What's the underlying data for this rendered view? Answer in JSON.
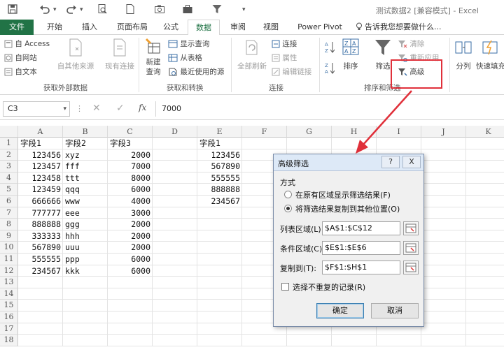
{
  "titlebar": {
    "doc_title": "测试数据2 [兼容模式] - Excel"
  },
  "tabs": [
    {
      "label": "文件"
    },
    {
      "label": "开始"
    },
    {
      "label": "插入"
    },
    {
      "label": "页面布局"
    },
    {
      "label": "公式"
    },
    {
      "label": "数据"
    },
    {
      "label": "审阅"
    },
    {
      "label": "视图"
    },
    {
      "label": "Power Pivot"
    },
    {
      "label": "告诉我您想要做什么..."
    }
  ],
  "active_tab": "数据",
  "ribbon": {
    "get_external": {
      "access": "自 Access",
      "web": "自网站",
      "text": "自文本",
      "other_sources": "自其他来源",
      "existing": "现有连接",
      "group_label": "获取外部数据"
    },
    "get_transform": {
      "show_query": "显示查询",
      "from_table": "从表格",
      "new_query": "新建",
      "new_query_2": "查询",
      "recent_sources": "最近使用的源",
      "group_label": "获取和转换"
    },
    "connections": {
      "refresh_all": "全部刷新",
      "connections": "连接",
      "properties": "属性",
      "edit_links": "编辑链接",
      "group_label": "连接"
    },
    "sort_filter": {
      "sort": "排序",
      "filter": "筛选",
      "clear": "清除",
      "reapply": "重新应用",
      "advanced": "高级",
      "group_label": "排序和筛选"
    },
    "tools": {
      "split": "分列",
      "flash_fill": "快速填充"
    }
  },
  "formula_bar": {
    "name_box": "C3",
    "formula": "7000"
  },
  "grid": {
    "columns": [
      "A",
      "B",
      "C",
      "D",
      "E",
      "F",
      "G",
      "H",
      "I",
      "J",
      "K"
    ],
    "rows": [
      "1",
      "2",
      "3",
      "4",
      "5",
      "6",
      "7",
      "8",
      "9",
      "10",
      "11",
      "12",
      "13",
      "14",
      "15",
      "16",
      "17",
      "18"
    ],
    "col_a": [
      "字段1",
      "123456",
      "123457",
      "123458",
      "123459",
      "666666",
      "777777",
      "888888",
      "333333",
      "567890",
      "555555",
      "234567"
    ],
    "col_b": [
      "字段2",
      "xyz",
      "fff",
      "ttt",
      "qqq",
      "www",
      "eee",
      "ggg",
      "hhh",
      "uuu",
      "ppp",
      "kkk"
    ],
    "col_c": [
      "字段3",
      "2000",
      "7000",
      "8000",
      "6000",
      "4000",
      "3000",
      "2000",
      "2000",
      "2000",
      "6000",
      "6000"
    ],
    "col_e": [
      "字段1",
      "123456",
      "567890",
      "555555",
      "888888",
      "234567"
    ]
  },
  "dialog": {
    "title": "高级筛选",
    "help": "?",
    "close": "X",
    "method_label": "方式",
    "option1": "在原有区域显示筛选结果(F)",
    "option2": "将筛选结果复制到其他位置(O)",
    "list_range_label": "列表区域(L):",
    "list_range_value": "$A$1:$C$12",
    "criteria_range_label": "条件区域(C):",
    "criteria_range_value": "$E$1:$E$6",
    "copy_to_label": "复制到(T):",
    "copy_to_value": "$F$1:$H$1",
    "unique_label": "选择不重复的记录(R)",
    "ok": "确定",
    "cancel": "取消"
  },
  "colors": {
    "excel_green": "#217346",
    "highlight_red": "#e0303a",
    "arrow_red": "#e0303a"
  }
}
